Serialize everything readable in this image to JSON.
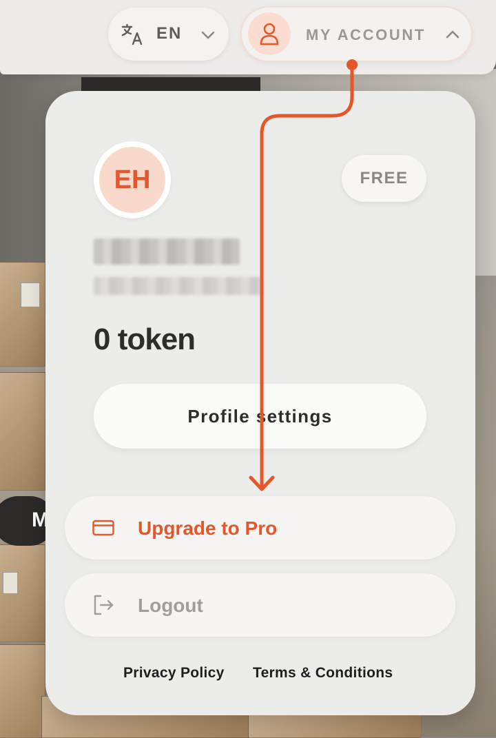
{
  "header": {
    "language": {
      "label": "EN",
      "icon": "translate-icon",
      "chevron": "chevron-down-icon"
    },
    "account": {
      "label": "MY ACCOUNT",
      "icon": "user-icon",
      "chevron": "chevron-up-icon"
    }
  },
  "account_menu": {
    "avatar_initials": "EH",
    "plan_badge": "FREE",
    "token_balance": "0 token",
    "profile_settings_label": "Profile settings",
    "upgrade": {
      "label": "Upgrade to Pro",
      "icon": "credit-card-icon"
    },
    "logout": {
      "label": "Logout",
      "icon": "logout-icon"
    },
    "footer": {
      "privacy_label": "Privacy Policy",
      "terms_label": "Terms & Conditions"
    }
  },
  "background": {
    "partial_pill_text": "M"
  },
  "colors": {
    "accent": "#e4572a",
    "accent_light": "#f9d9cc",
    "card_bg": "#ececea",
    "muted_text": "#9b9894"
  }
}
